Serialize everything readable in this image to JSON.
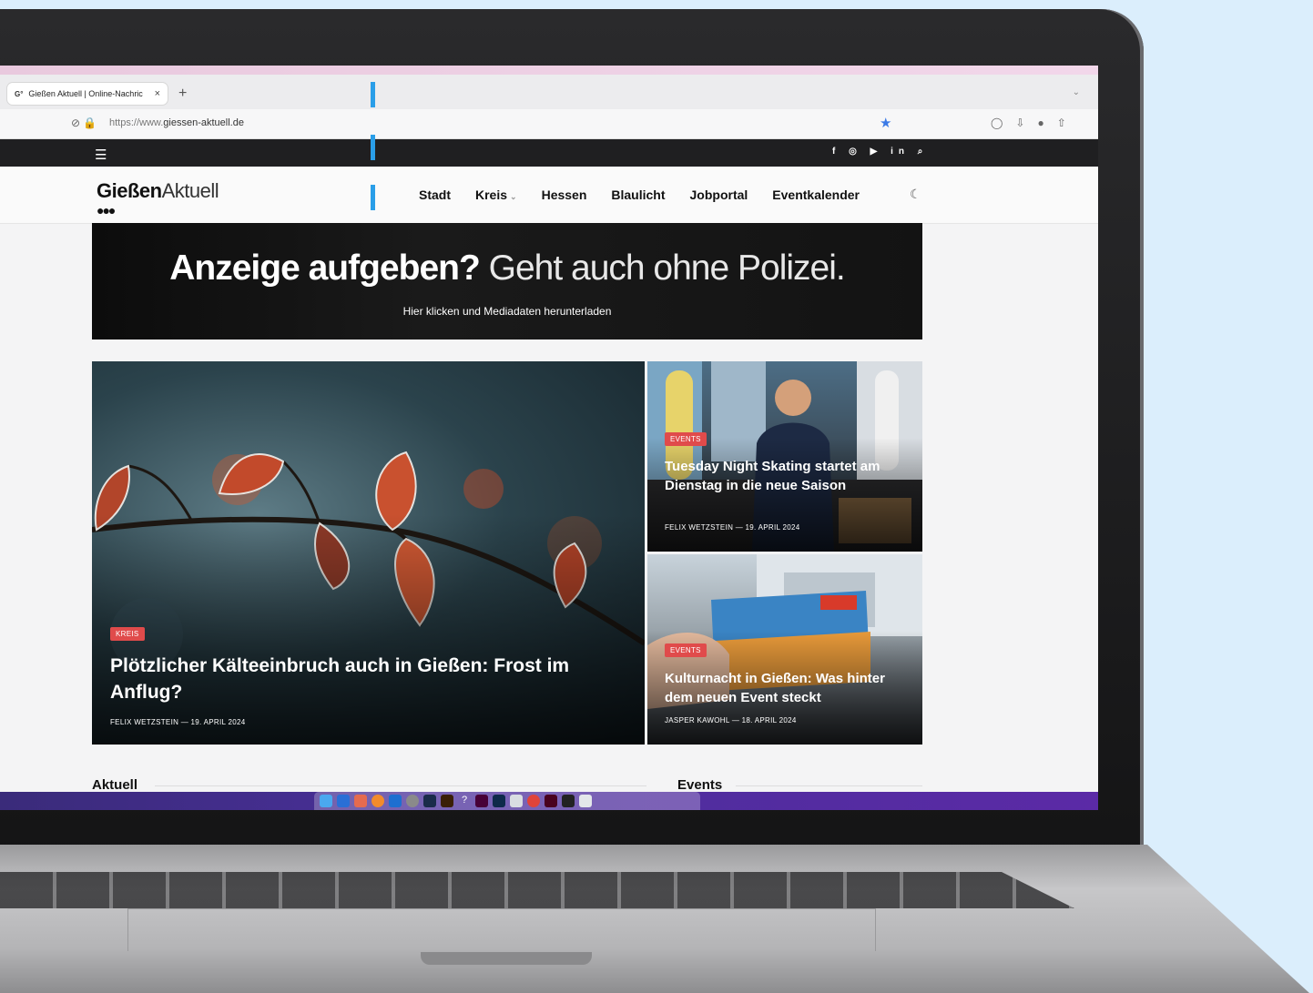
{
  "browser": {
    "tab_title": "Gießen Aktuell | Online-Nachric",
    "tab_favicon": "G°",
    "tab_close": "×",
    "new_tab": "+",
    "url_prefix": "https://www.",
    "url_domain": "giessen-aktuell.de"
  },
  "topbar": {
    "social_icons": [
      "facebook-icon",
      "instagram-icon",
      "youtube-icon",
      "linkedin-icon",
      "search-icon"
    ],
    "social_glyphs": "f ◎ ▶ in ⌕"
  },
  "header": {
    "logo_bold": "Gießen",
    "logo_light": "Aktuell",
    "nav": [
      "Stadt",
      "Kreis",
      "Hessen",
      "Blaulicht",
      "Jobportal",
      "Eventkalender"
    ]
  },
  "ad": {
    "headline_bold": "Anzeige aufgeben?",
    "headline_light": "Geht auch ohne Polizei.",
    "subline": "Hier klicken und Mediadaten herunterladen"
  },
  "articles": {
    "main": {
      "category": "KREIS",
      "title": "Plötzlicher Kälteeinbruch auch in Gießen: Frost im Anflug?",
      "meta": "FELIX WETZSTEIN — 19. APRIL 2024"
    },
    "side1": {
      "category": "EVENTS",
      "title": "Tuesday Night Skating startet am Dienstag in die neue Saison",
      "meta": "FELIX WETZSTEIN — 19. APRIL 2024"
    },
    "side2": {
      "category": "EVENTS",
      "title": "Kulturnacht in Gießen: Was hinter dem neuen Event steckt",
      "meta": "JASPER KAWOHL — 18. APRIL 2024"
    }
  },
  "sections": {
    "left": "Aktuell",
    "right": "Events"
  },
  "colors": {
    "accent_blue": "#2a9ee8",
    "badge_red": "#e04b4b",
    "topbar": "#1f1f21"
  }
}
